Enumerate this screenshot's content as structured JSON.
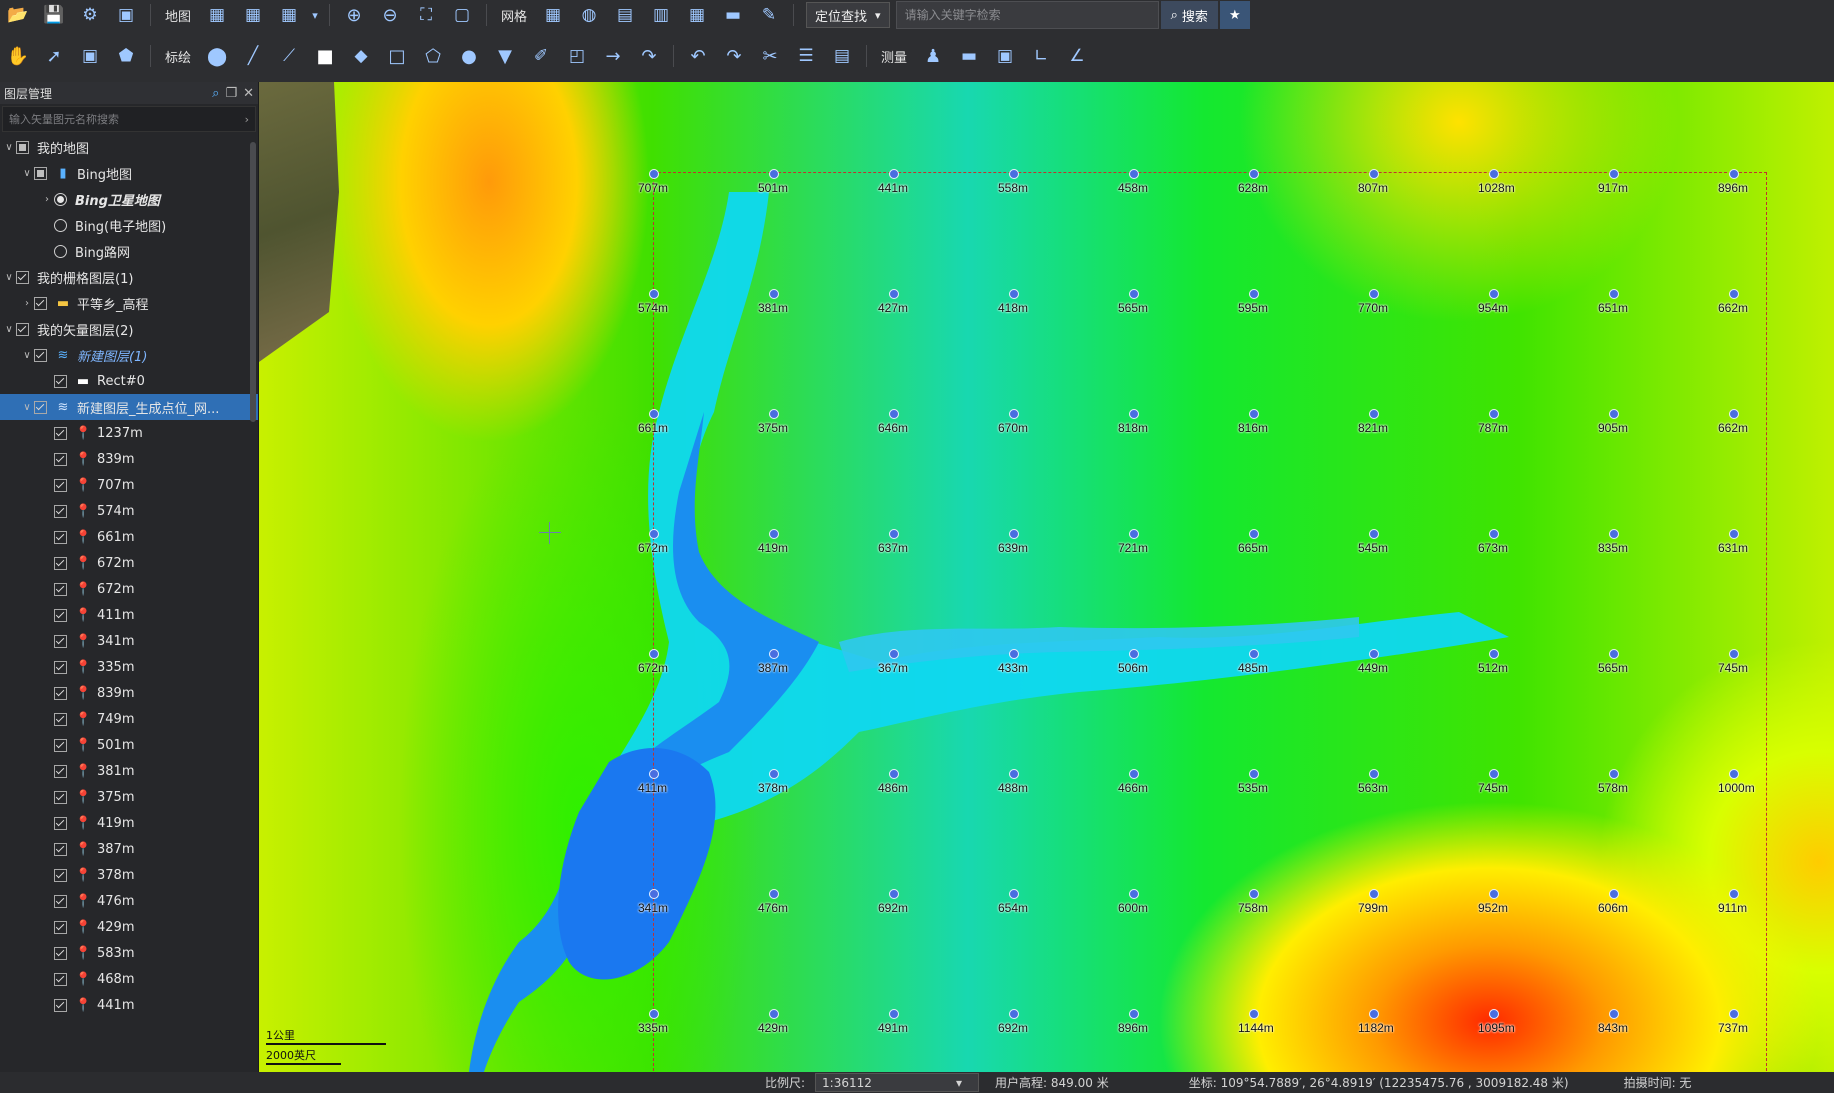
{
  "toolbar1": {
    "map_label": "地图",
    "grid_label": "网格",
    "locate_label": "定位查找",
    "search_placeholder": "请输入关键字检索",
    "search_button": "搜索"
  },
  "toolbar2": {
    "annotate_label": "标绘",
    "measure_label": "测量"
  },
  "panel": {
    "title": "图层管理",
    "filter_placeholder": "输入矢量图元名称搜索",
    "tree": {
      "my_map": "我的地图",
      "bing_map": "Bing地图",
      "bing_satellite": "Bing卫星地图",
      "bing_electronic": "Bing(电子地图)",
      "bing_road": "Bing路网",
      "raster_group": "我的栅格图层(1)",
      "raster_layer": "平等乡_高程",
      "vector_group": "我的矢量图层(2)",
      "new_layer": "新建图层(1)",
      "rect": "Rect#0",
      "points_layer": "新建图层_生成点位_网...",
      "points": [
        "1237m",
        "839m",
        "707m",
        "574m",
        "661m",
        "672m",
        "672m",
        "411m",
        "341m",
        "335m",
        "839m",
        "749m",
        "501m",
        "381m",
        "375m",
        "419m",
        "387m",
        "378m",
        "476m",
        "429m",
        "583m",
        "468m",
        "441m"
      ]
    }
  },
  "map": {
    "grid_labels": [
      [
        "707m",
        "501m",
        "441m",
        "558m",
        "458m",
        "628m",
        "807m",
        "1028m",
        "917m",
        "896m"
      ],
      [
        "574m",
        "381m",
        "427m",
        "418m",
        "565m",
        "595m",
        "770m",
        "954m",
        "651m",
        "662m"
      ],
      [
        "661m",
        "375m",
        "646m",
        "670m",
        "818m",
        "816m",
        "821m",
        "787m",
        "905m",
        "662m"
      ],
      [
        "672m",
        "419m",
        "637m",
        "639m",
        "721m",
        "665m",
        "545m",
        "673m",
        "835m",
        "631m"
      ],
      [
        "672m",
        "387m",
        "367m",
        "433m",
        "506m",
        "485m",
        "449m",
        "512m",
        "565m",
        "745m"
      ],
      [
        "411m",
        "378m",
        "486m",
        "488m",
        "466m",
        "535m",
        "563m",
        "745m",
        "578m",
        "1000m"
      ],
      [
        "341m",
        "476m",
        "692m",
        "654m",
        "600m",
        "758m",
        "799m",
        "952m",
        "606m",
        "911m"
      ],
      [
        "335m",
        "429m",
        "491m",
        "692m",
        "896m",
        "1144m",
        "1182m",
        "1095m",
        "843m",
        "737m"
      ]
    ],
    "scale_top": "1公里",
    "scale_bottom": "2000英尺"
  },
  "status": {
    "scale_label": "比例尺:",
    "scale_value": "1:36112",
    "elevation": "用户高程: 849.00 米",
    "coords": "坐标: 109°54.7889′, 26°4.8919′ (12235475.76 , 3009182.48 米)",
    "capture_time": "拍摄时间: 无"
  }
}
